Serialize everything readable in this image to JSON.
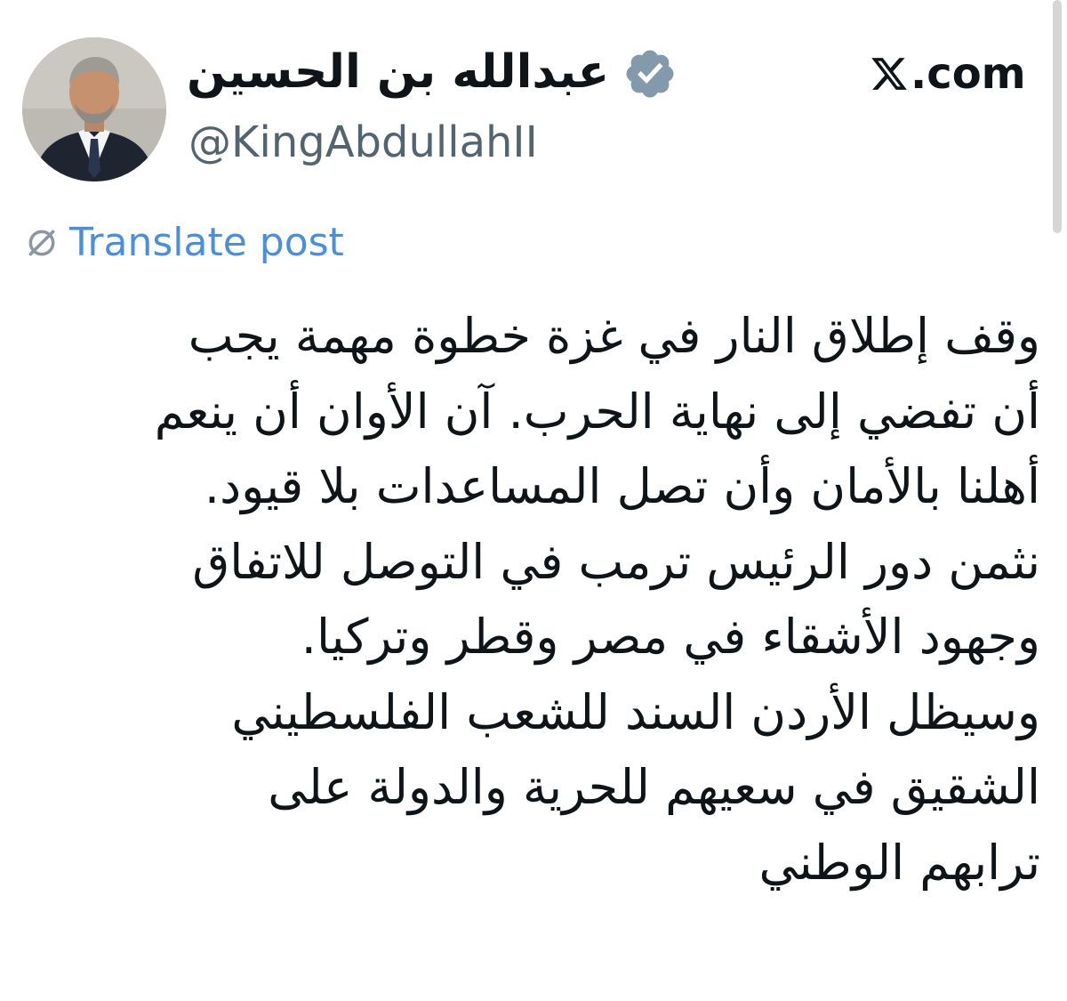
{
  "author": {
    "display_name": "عبدالله بن الحسين",
    "handle": "@KingAbdullahII",
    "verified_icon": "verified-badge-icon",
    "avatar_icon": "profile-photo"
  },
  "site": {
    "logo_icon": "x-logo-icon",
    "domain": ".com"
  },
  "translate": {
    "icon": "globe-icon",
    "label": "Translate post",
    "color": "#4a8fd8"
  },
  "post": {
    "lines": [
      "وقف إطلاق النار في غزة خطوة مهمة يجب",
      "أن تفضي إلى نهاية الحرب. آن الأوان أن ينعم",
      "أهلنا بالأمان وأن تصل المساعدات بلا قيود.",
      "نثمن دور الرئيس ترمب في التوصل للاتفاق",
      "وجهود الأشقاء في مصر وقطر وتركيا.",
      "وسيظل الأردن السند للشعب الفلسطيني",
      "الشقيق في سعيهم للحرية والدولة على",
      "ترابهم الوطني"
    ]
  },
  "colors": {
    "text": "#0f1419",
    "secondary_text": "#536471",
    "verified_badge": "#829aab",
    "background": "#ffffff"
  }
}
